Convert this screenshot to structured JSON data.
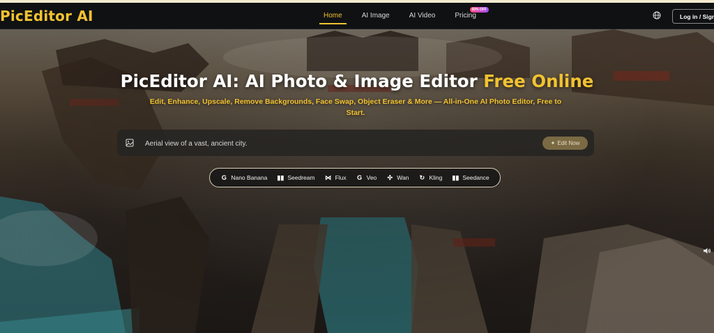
{
  "header": {
    "logo": "PicEditor AI",
    "nav": [
      {
        "label": "Home",
        "active": true
      },
      {
        "label": "AI Image",
        "active": false
      },
      {
        "label": "AI Video",
        "active": false
      },
      {
        "label": "Pricing",
        "active": false,
        "badge": "50% OFF"
      }
    ],
    "globe_icon": "globe-icon",
    "login_label": "Log in / Sign Up"
  },
  "hero": {
    "title_main": "PicEditor AI: AI Photo & Image Editor ",
    "title_highlight": "Free Online",
    "subtitle": "Edit, Enhance, Upscale, Remove Backgrounds, Face Swap, Object Eraser & More — All-in-One AI Photo Editor, Free to Start.",
    "prompt": {
      "value": "Aerial view of a vast, ancient city.",
      "icon": "image-icon",
      "button_label": "Edit Now",
      "button_icon": "sparkle-icon"
    },
    "models": [
      {
        "icon": "G",
        "label": "Nano Banana"
      },
      {
        "icon": "▮▮",
        "label": "Seedream"
      },
      {
        "icon": "⋈",
        "label": "Flux"
      },
      {
        "icon": "G",
        "label": "Veo"
      },
      {
        "icon": "✣",
        "label": "Wan"
      },
      {
        "icon": "↻",
        "label": "Kling"
      },
      {
        "icon": "▮▮",
        "label": "Seedance"
      }
    ],
    "speaker_icon": "speaker-icon"
  },
  "colors": {
    "accent": "#f2c230",
    "navbar": "#0f1113",
    "button": "#7a6a44"
  }
}
